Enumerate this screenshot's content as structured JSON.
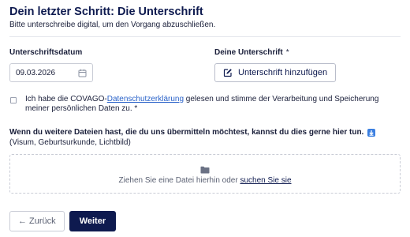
{
  "header": {
    "title": "Dein letzter Schritt: Die Unterschrift",
    "subtitle": "Bitte unterschreibe digital, um den Vorgang abzuschließen."
  },
  "date_field": {
    "label": "Unterschriftsdatum",
    "value": "09.03.2026",
    "icon": "calendar-icon"
  },
  "signature": {
    "label": "Deine Unterschrift",
    "required_marker": "*",
    "button_label": "Unterschrift hinzufügen",
    "button_icon": "pen-square-icon"
  },
  "consent": {
    "checked": false,
    "text_before": "Ich habe die COVAGO-",
    "link_text": "Datenschutzerklärung",
    "text_after": " gelesen und stimme der Verarbeitung und Speicherung meiner persönlichen Daten zu. *"
  },
  "upload": {
    "heading": "Wenn du weitere Dateien hast, die du uns übermitteln möchtest, kannst du dies gerne hier tun.",
    "heading_icon": "info-download-icon",
    "hint": "(Visum, Geburtsurkunde, Lichtbild)",
    "dropzone_icon": "folder-icon",
    "drop_text": "Ziehen Sie eine Datei hierhin oder ",
    "drop_link": "suchen Sie sie"
  },
  "actions": {
    "back_label": "← Zurück",
    "next_label": "Weiter"
  },
  "colors": {
    "primary": "#0e1a4f",
    "link": "#2962c9",
    "border": "#c9ccd6"
  }
}
